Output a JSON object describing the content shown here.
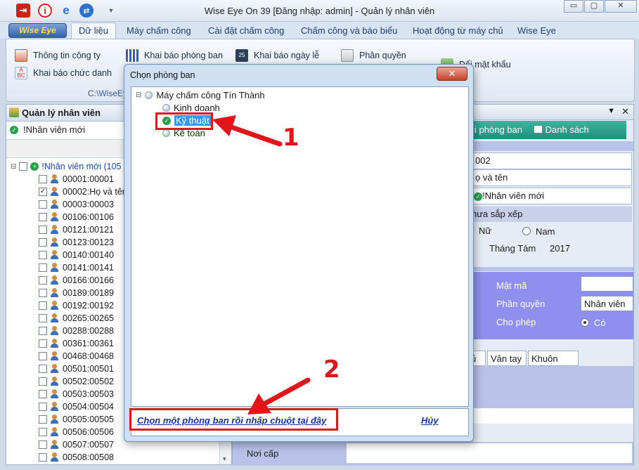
{
  "window": {
    "title": "Wise Eye On 39 [Đăng nhập: admin] - Quản lý nhân viên",
    "min_label": "▭",
    "max_label": "▢",
    "close_label": "✕"
  },
  "quick_access": {
    "exit_icon": "exit-icon",
    "info_icon": "info-icon",
    "ie_icon": "browser-icon",
    "teamviewer_icon": "remote-icon",
    "dropdown": "▾"
  },
  "ribbon": {
    "logo_label": "Wise Eye",
    "tabs": [
      "Dữ liệu",
      "Máy chấm công",
      "Cài đặt chấm công",
      "Chấm công và báo biểu",
      "Hoạt động từ máy chủ",
      "Wise Eye"
    ],
    "items": {
      "company_info": "Thông tin công ty",
      "job_title": "Khai báo chức danh",
      "department": "Khai báo phòng ban",
      "holiday": "Khai báo ngày lễ",
      "permission": "Phân quyền",
      "change_password": "Đổi mật khẩu",
      "group_path": "C:\\WiseEye"
    }
  },
  "left_panel": {
    "header": "Quản lý nhân viên",
    "filter": "!Nhân viên mới",
    "root": "!Nhân viên mới (105",
    "employees": [
      "00001:00001",
      "00002:Họ và tên",
      "00003:00003",
      "00106:00106",
      "00121:00121",
      "00123:00123",
      "00140:00140",
      "00141:00141",
      "00166:00166",
      "00189:00189",
      "00192:00192",
      "00265:00265",
      "00288:00288",
      "00361:00361",
      "00468:00468",
      "00501:00501",
      "00502:00502",
      "00503:00503",
      "00504:00504",
      "00505:00505",
      "00506:00506",
      "00507:00507",
      "00508:00508"
    ]
  },
  "right_panel": {
    "tab_department": "i phòng ban",
    "tab_list": "Danh sách",
    "code": "002",
    "name": "ọ và tên",
    "group": "!Nhân viên mới",
    "sort": "hưa sắp xếp",
    "gender_female": "Nữ",
    "gender_male": "Nam",
    "month": "Tháng Tám",
    "year": "2017",
    "password_label": "Mật mã",
    "role_label": "Phần quyền",
    "role_value": "Nhân viên",
    "allow_label": "Cho phép",
    "allow_value": "Có",
    "sub_tab_1": "ủ",
    "sub_tab_2": "Vân tay",
    "sub_tab_3": "Khuôn mặt",
    "issue_place": "Nơi cấp"
  },
  "dialog": {
    "title": "Chọn phòng ban",
    "close_label": "✕",
    "root": "Máy chấm công Tín Thành",
    "departments": [
      "Kinh doanh",
      "Kỹ thuật",
      "Kế toán"
    ],
    "selected_department": "Kỹ thuật",
    "confirm_link": "Chọn một phòng ban rồi nhấp chuột tại đây",
    "cancel_link": "Hủy"
  },
  "annotations": {
    "step1": "1",
    "step2": "2",
    "color": "#e0161b"
  }
}
